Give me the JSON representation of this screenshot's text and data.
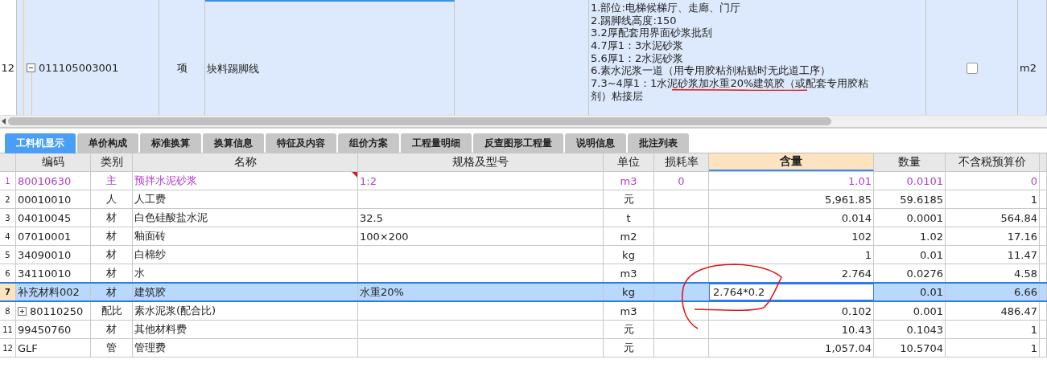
{
  "top_row": {
    "row_number": "12",
    "code": "011105003001",
    "expanded": true,
    "type": "项",
    "name": "块料踢脚线",
    "selected": true,
    "checked": false,
    "unit": "m2",
    "description": [
      "1.部位:电梯候梯厅、走廊、门厅",
      "2.踢脚线高度:150",
      "3.2厚配套用界面砂浆批刮",
      "4.7厚1：3水泥砂浆",
      "5.6厚1：2水泥砂浆",
      "6.素水泥浆一道（用专用胶粘剂粘贴时无此道工序）",
      "7.3~4厚1：1水泥砂浆加水重20%建筑胶（或配套专用胶粘",
      "剂）粘接层"
    ]
  },
  "tabs": [
    {
      "label": "工料机显示",
      "selected": true
    },
    {
      "label": "单价构成",
      "selected": false
    },
    {
      "label": "标准换算",
      "selected": false
    },
    {
      "label": "换算信息",
      "selected": false
    },
    {
      "label": "特征及内容",
      "selected": false
    },
    {
      "label": "组价方案",
      "selected": false
    },
    {
      "label": "工程量明细",
      "selected": false
    },
    {
      "label": "反查图形工程量",
      "selected": false
    },
    {
      "label": "说明信息",
      "selected": false
    },
    {
      "label": "批注列表",
      "selected": false
    }
  ],
  "materials": {
    "columns": [
      {
        "label": "编码",
        "selected": false
      },
      {
        "label": "类别",
        "selected": false
      },
      {
        "label": "名称",
        "selected": false
      },
      {
        "label": "规格及型号",
        "selected": false
      },
      {
        "label": "单位",
        "selected": false
      },
      {
        "label": "损耗率",
        "selected": false
      },
      {
        "label": "含量",
        "selected": true
      },
      {
        "label": "数量",
        "selected": false
      },
      {
        "label": "不含税预算价",
        "selected": false
      }
    ],
    "rows": [
      {
        "row_number": "1",
        "code": "80010630",
        "category": "主",
        "name": "预拌水泥砂浆",
        "spec": "1:2",
        "unit": "m3",
        "loss_rate": "0",
        "content": "1.01",
        "quantity": "0.0101",
        "price": "0",
        "main": true,
        "has_comment": true,
        "selected": false
      },
      {
        "row_number": "2",
        "code": "00010010",
        "category": "人",
        "name": "人工费",
        "spec": "",
        "unit": "元",
        "loss_rate": "",
        "content": "5,961.85",
        "quantity": "59.6185",
        "price": "1",
        "main": false,
        "has_comment": false,
        "selected": false
      },
      {
        "row_number": "3",
        "code": "04010045",
        "category": "材",
        "name": "白色硅酸盐水泥",
        "spec": "32.5",
        "unit": "t",
        "loss_rate": "",
        "content": "0.014",
        "quantity": "0.0001",
        "price": "564.84",
        "main": false,
        "has_comment": false,
        "selected": false
      },
      {
        "row_number": "4",
        "code": "07010001",
        "category": "材",
        "name": "釉面砖",
        "spec": "100×200",
        "unit": "m2",
        "loss_rate": "",
        "content": "102",
        "quantity": "1.02",
        "price": "17.16",
        "main": false,
        "has_comment": false,
        "selected": false
      },
      {
        "row_number": "5",
        "code": "34090010",
        "category": "材",
        "name": "白棉纱",
        "spec": "",
        "unit": "kg",
        "loss_rate": "",
        "content": "1",
        "quantity": "0.01",
        "price": "11.47",
        "main": false,
        "has_comment": false,
        "selected": false
      },
      {
        "row_number": "6",
        "code": "34110010",
        "category": "材",
        "name": "水",
        "spec": "",
        "unit": "m3",
        "loss_rate": "",
        "content": "2.764",
        "quantity": "0.0276",
        "price": "4.58",
        "main": false,
        "has_comment": false,
        "selected": false
      },
      {
        "row_number": "7",
        "code": "补充材料002",
        "category": "材",
        "name": "建筑胶",
        "spec": "水重20%",
        "unit": "kg",
        "loss_rate": "",
        "content": "2.764*0.2",
        "quantity": "0.01",
        "price": "6.66",
        "main": false,
        "has_comment": false,
        "selected": true
      },
      {
        "row_number": "8",
        "code": "80110250",
        "expanded": false,
        "category": "配比",
        "name": "素水泥浆(配合比)",
        "spec": "",
        "unit": "m3",
        "loss_rate": "",
        "content": "0.102",
        "quantity": "0.001",
        "price": "486.47",
        "main": false,
        "has_comment": false,
        "selected": false
      },
      {
        "row_number": "11",
        "code": "99450760",
        "category": "材",
        "name": "其他材料费",
        "spec": "",
        "unit": "元",
        "loss_rate": "",
        "content": "10.43",
        "quantity": "0.1043",
        "price": "1",
        "main": false,
        "has_comment": false,
        "selected": false
      },
      {
        "row_number": "12",
        "code": "GLF",
        "category": "管",
        "name": "管理费",
        "spec": "",
        "unit": "元",
        "loss_rate": "",
        "content": "1,057.04",
        "quantity": "10.5704",
        "price": "1",
        "main": false,
        "has_comment": false,
        "selected": false
      }
    ]
  }
}
